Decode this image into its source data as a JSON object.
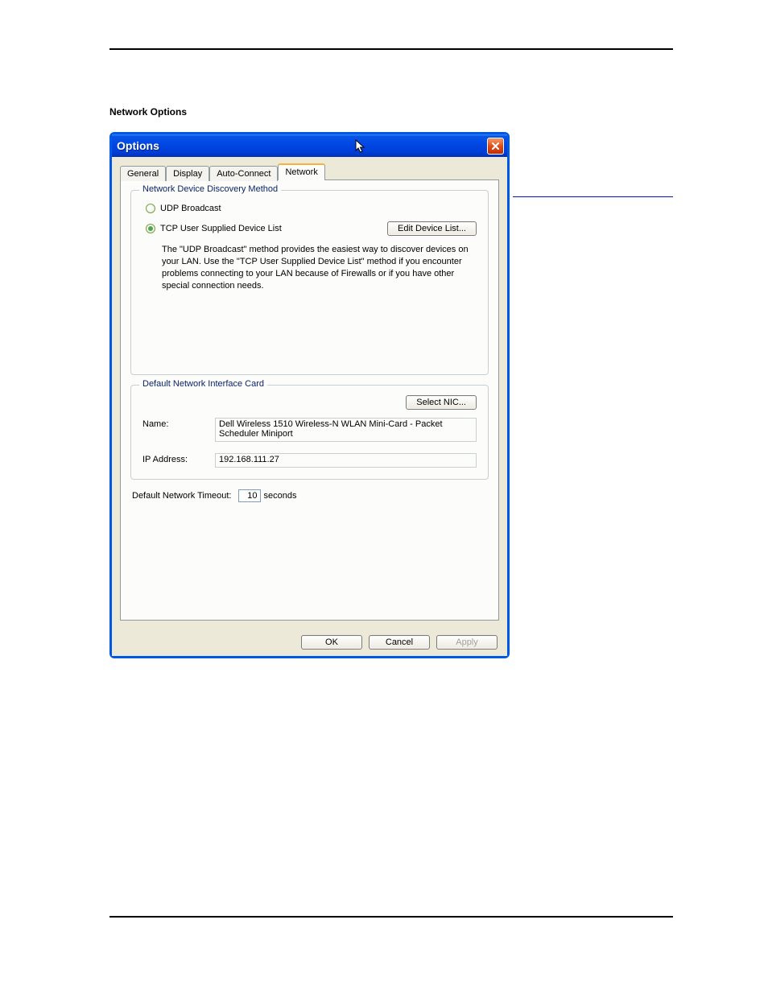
{
  "heading": "Network Options",
  "window": {
    "title": "Options",
    "tabs": [
      "General",
      "Display",
      "Auto-Connect",
      "Network"
    ],
    "active_tab": "Network"
  },
  "discovery": {
    "group_title": "Network Device Discovery Method",
    "option_udp": "UDP Broadcast",
    "option_tcp": "TCP User Supplied Device List",
    "edit_button": "Edit Device List...",
    "description": "The \"UDP Broadcast\" method provides the easiest way to discover devices on your LAN.  Use the \"TCP User Supplied Device List\" method if you encounter problems connecting to your LAN because of Firewalls or if you have other special connection needs."
  },
  "nic": {
    "group_title": "Default Network Interface Card",
    "select_button": "Select NIC...",
    "name_label": "Name:",
    "name_value": "Dell Wireless 1510 Wireless-N WLAN Mini-Card - Packet Scheduler Miniport",
    "ip_label": "IP Address:",
    "ip_value": "192.168.111.27"
  },
  "timeout": {
    "label": "Default Network Timeout:",
    "value": "10",
    "unit": "seconds"
  },
  "buttons": {
    "ok": "OK",
    "cancel": "Cancel",
    "apply": "Apply"
  }
}
